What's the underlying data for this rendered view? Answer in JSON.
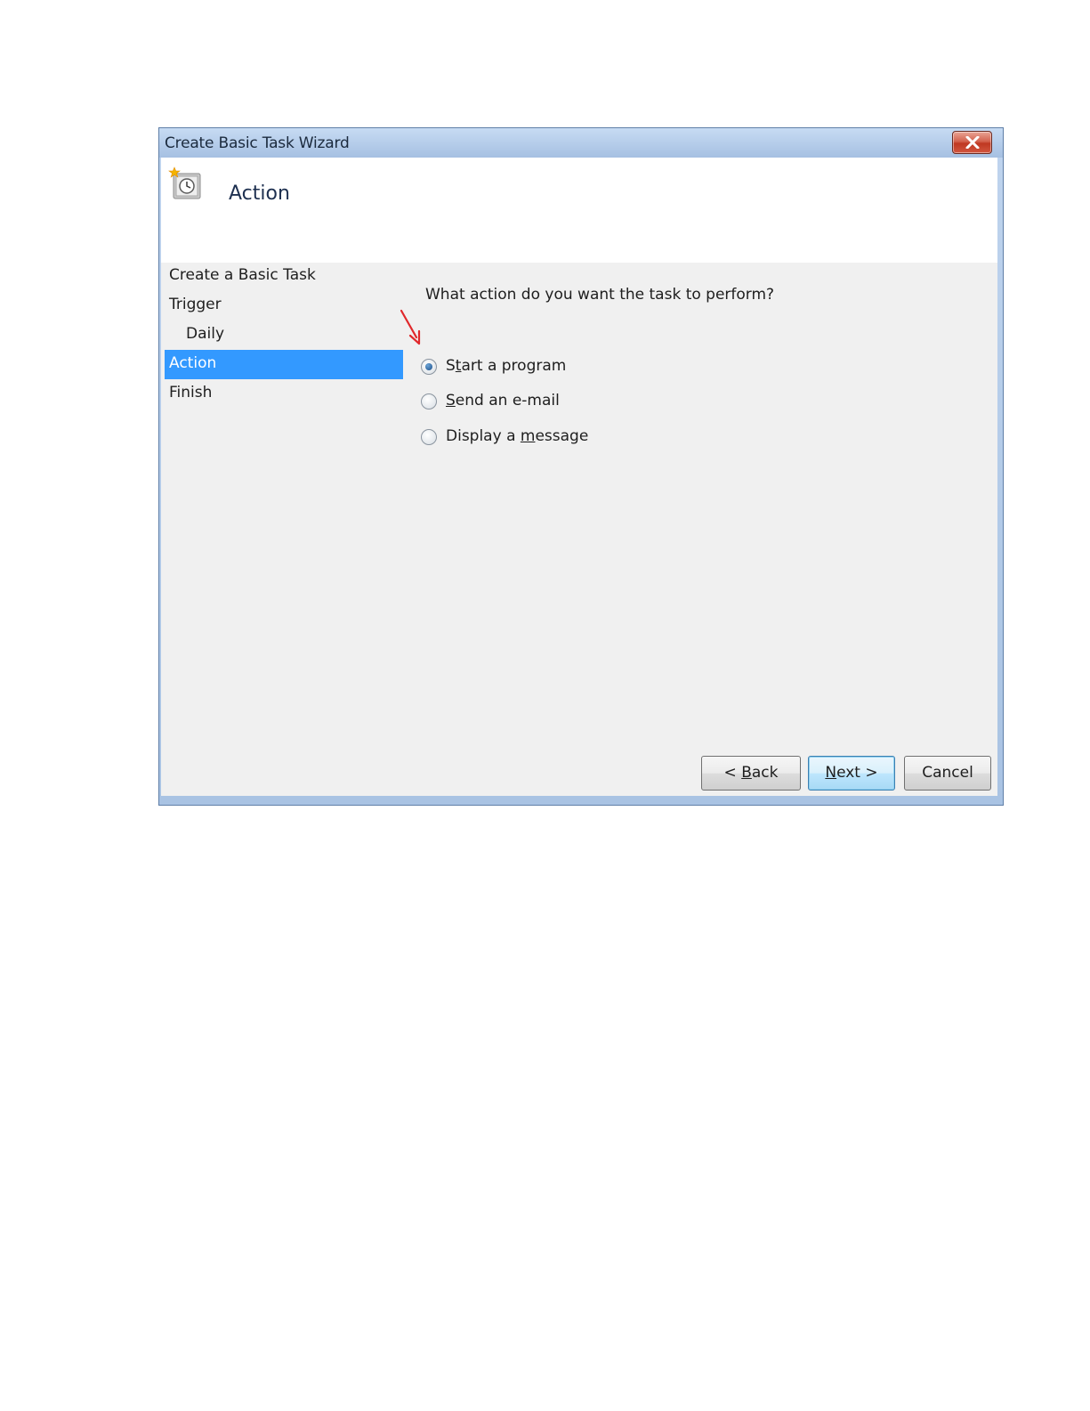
{
  "window": {
    "title": "Create Basic Task Wizard"
  },
  "header": {
    "title": "Action",
    "icon": "task-scheduler-icon"
  },
  "nav": {
    "items": [
      {
        "label": "Create a Basic Task",
        "selected": false,
        "indent": false
      },
      {
        "label": "Trigger",
        "selected": false,
        "indent": false
      },
      {
        "label": "Daily",
        "selected": false,
        "indent": true
      },
      {
        "label": "Action",
        "selected": true,
        "indent": false
      },
      {
        "label": "Finish",
        "selected": false,
        "indent": false
      }
    ]
  },
  "content": {
    "question": "What action do you want the task to perform?",
    "options": [
      {
        "pre": "S",
        "accel": "t",
        "post": "art a program",
        "checked": true
      },
      {
        "pre": "",
        "accel": "S",
        "post": "end an e-mail",
        "checked": false
      },
      {
        "pre": "Display a ",
        "accel": "m",
        "post": "essage",
        "checked": false
      }
    ]
  },
  "buttons": {
    "back": {
      "pre": "< ",
      "accel": "B",
      "post": "ack"
    },
    "next": {
      "pre": "",
      "accel": "N",
      "post": "ext >"
    },
    "cancel": {
      "label": "Cancel"
    }
  },
  "colors": {
    "selection": "#3399ff",
    "annotation_arrow": "#e0282b"
  }
}
